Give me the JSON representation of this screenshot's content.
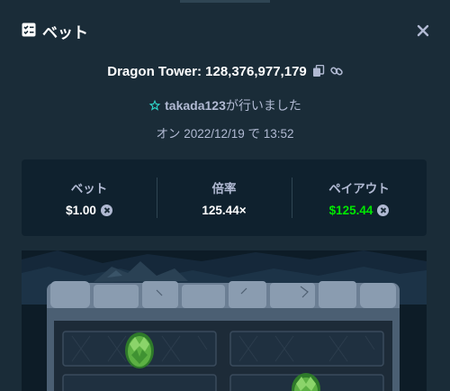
{
  "header": {
    "title": "ベット",
    "icons": {
      "title": "bet-slip-icon",
      "close": "close-icon"
    }
  },
  "game": {
    "title": "Dragon Tower: 128,376,977,179",
    "icons": {
      "copy": "copy-icon",
      "link": "link-icon"
    }
  },
  "user": {
    "name": "takada123",
    "suffix": "が行いました",
    "badge_icon": "vip-star-icon"
  },
  "date_text": "オン 2022/12/19 で 13:52",
  "stats": {
    "bet": {
      "label": "ベット",
      "value": "$1.00",
      "currency_icon": "currency-icon"
    },
    "multiplier": {
      "label": "倍率",
      "value": "125.44×"
    },
    "payout": {
      "label": "ペイアウト",
      "value": "$125.44",
      "currency_icon": "currency-icon"
    }
  },
  "colors": {
    "background": "#1a2c38",
    "card": "#0f212e",
    "muted_text": "#b1bad3",
    "payout_green": "#00e701"
  }
}
